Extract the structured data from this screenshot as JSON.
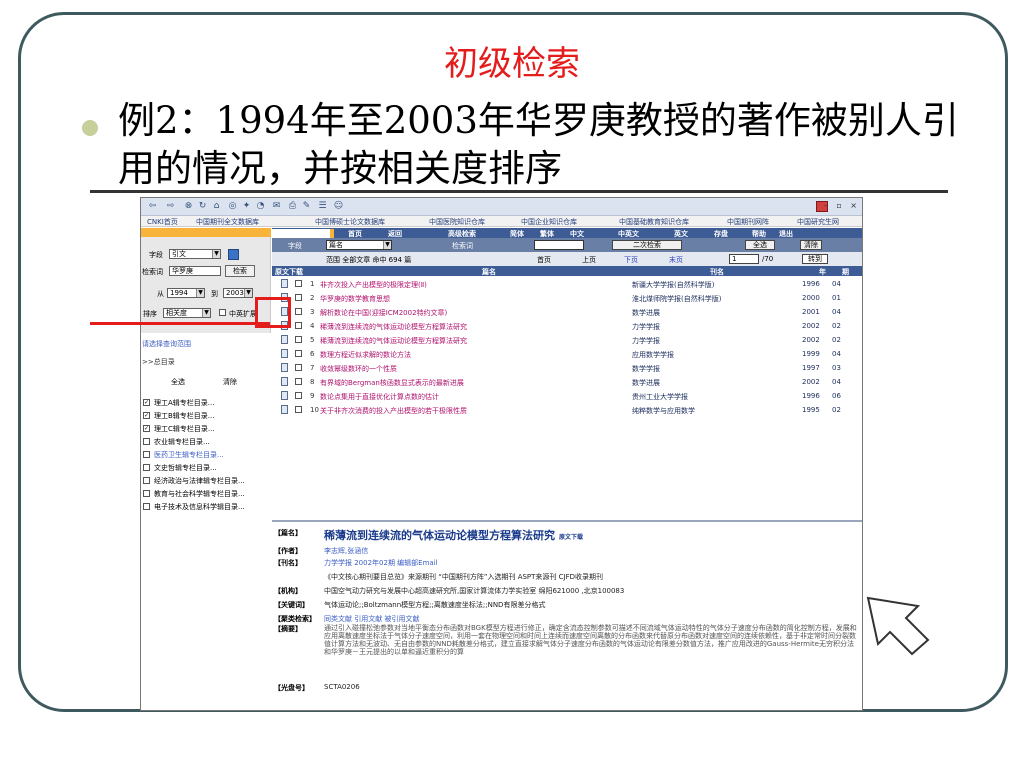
{
  "slide": {
    "title": "初级检索",
    "bullet": "例2：1994年至2003年华罗庚教授的著作被别人引用的情况，并按相关度排序"
  },
  "browser": {
    "toolbar_icons": [
      "back-icon",
      "forward-icon",
      "stop-icon",
      "refresh-icon",
      "home-icon",
      "search-icon",
      "favorites-icon",
      "history-icon",
      "mail-icon",
      "print-icon",
      "edit-icon",
      "discuss-icon",
      "messenger-icon"
    ]
  },
  "topnav": [
    "CNKI首页",
    "中国期刊全文数据库",
    "中国博硕士论文数据库",
    "中国医院知识仓库",
    "中国企业知识仓库",
    "中国基础教育知识仓库",
    "中国期刊网阵",
    "中国研究生网"
  ],
  "sidebar": {
    "field_label": "字段",
    "field_value": "引文",
    "keyword_label": "检索词",
    "keyword_value": "华罗庚",
    "search_btn": "检索",
    "from_label": "从",
    "from_year": "1994",
    "to_label": "到",
    "to_year": "2003",
    "sort_label": "排序",
    "sort_value": "相关度",
    "match_label": "中英扩展",
    "scope_link": "请选择查询范围",
    "total_dir": ">>总目录",
    "select_all": "全选",
    "clear": "清除",
    "categories": [
      {
        "label": "理工A辑专栏目录...",
        "checked": true,
        "link": false
      },
      {
        "label": "理工B辑专栏目录...",
        "checked": true,
        "link": false
      },
      {
        "label": "理工C辑专栏目录...",
        "checked": true,
        "link": false
      },
      {
        "label": "农业辑专栏目录...",
        "checked": false,
        "link": false
      },
      {
        "label": "医药卫生辑专栏目录...",
        "checked": false,
        "link": true
      },
      {
        "label": "文史哲辑专栏目录...",
        "checked": false,
        "link": false
      },
      {
        "label": "经济政治与法律辑专栏目录...",
        "checked": false,
        "link": false
      },
      {
        "label": "教育与社会科学辑专栏目录...",
        "checked": false,
        "link": false
      },
      {
        "label": "电子技术及信息科学辑目录...",
        "checked": false,
        "link": false
      }
    ]
  },
  "menubar": [
    "首页",
    "返回",
    "高级检索",
    "简体",
    "繁体",
    "中文",
    "中英文",
    "英文",
    "存盘",
    "帮助",
    "退出"
  ],
  "fieldrow": {
    "field_label": "字段",
    "field_value": "篇名",
    "keyword_label": "检索词",
    "secondary_btn": "二次检索",
    "select_all_btn": "全选",
    "clear_btn": "清除"
  },
  "rangerow": {
    "summary": "范围 全部文章 命中 694 篇",
    "first": "首页",
    "prev": "上页",
    "next": "下页",
    "last": "末页",
    "page": "1",
    "total_pages": "/70",
    "goto": "转到"
  },
  "table": {
    "headers": {
      "download": "原文下载",
      "title": "篇名",
      "journal": "刊名",
      "year": "年",
      "issue": "期"
    },
    "rows": [
      {
        "num": "1",
        "title": "非齐次投入产出模型的极限定理(Ⅱ)",
        "journal": "新疆大学学报(自然科学版)",
        "year": "1996",
        "issue": "04"
      },
      {
        "num": "2",
        "title": "华罗庚的数学教育思想",
        "journal": "淮北煤师院学报(自然科学版)",
        "year": "2000",
        "issue": "01"
      },
      {
        "num": "3",
        "title": "解析数论在中国(迎接ICM2002特约文章)",
        "journal": "数学进展",
        "year": "2001",
        "issue": "04"
      },
      {
        "num": "4",
        "title": "稀薄流到连续流的气体运动论模型方程算法研究",
        "journal": "力学学报",
        "year": "2002",
        "issue": "02"
      },
      {
        "num": "5",
        "title": "稀薄流到连续流的气体运动论模型方程算法研究",
        "journal": "力学学报",
        "year": "2002",
        "issue": "02"
      },
      {
        "num": "6",
        "title": "数理方程近似求解的数论方法",
        "journal": "应用数学学报",
        "year": "1999",
        "issue": "04"
      },
      {
        "num": "7",
        "title": "收敛幂级数环的一个性质",
        "journal": "数学学报",
        "year": "1997",
        "issue": "03"
      },
      {
        "num": "8",
        "title": "有界域的Bergman核函数显式表示的最新进展",
        "journal": "数学进展",
        "year": "2002",
        "issue": "04"
      },
      {
        "num": "9",
        "title": "数论点集用于直接优化计算点数的估计",
        "journal": "贵州工业大学学报",
        "year": "1996",
        "issue": "06"
      },
      {
        "num": "10",
        "title": "关于非齐次消费的投入产出模型的若干极限性质",
        "journal": "纯粹数学与应用数学",
        "year": "1995",
        "issue": "02"
      }
    ]
  },
  "detail": {
    "title_label": "【篇名】",
    "title": "稀薄流到连续流的气体运动论模型方程算法研究",
    "download": "原文下载",
    "author_label": "【作者】",
    "author": "李志辉,张涵信",
    "journal_label": "【刊名】",
    "journal": "力学学报 2002年02期 编辑部Email",
    "index_line": "《中文核心期刊要目总览》来源期刊 “中国期刊方阵”入选期刊 ASPT来源刊 CJFD收录期刊",
    "org_label": "【机构】",
    "org": "中国空气动力研究与发展中心超高速研究所,国家计算流体力学实验室 绵阳621000 ,北京100083",
    "keywords_label": "【关键词】",
    "keywords": "气体运动论;;Boltzmann模型方程;;离散速度坐标法;;NND有限差分格式",
    "links_label": "【聚类检索】",
    "links": "同类文献 引用文献 被引用文献",
    "abstract_label": "【摘要】",
    "abstract": "通过引入碰撞松弛参数对当地平衡态分布函数对BGK模型方程进行修正，确定含流态控制参数可描述不同流域气体运动特性的气体分子速度分布函数的简化控制方程，发展和应用离散速度坐标法于气体分子速度空间，利用一套在物理空间和时间上连续而速度空间离散的分布函数来代替原分布函数对速度空间的连续依赖性，基于非定常时间分裂数值计算方法和无波动、无自由参数的NND耗散差分格式，建立直接求解气体分子速度分布函数的气体运动论有限差分数值方法，推广应用改进的Gauss-Hermite无穷积分法和华罗庚－王元提出的以单和逼近重积分的算",
    "disc_label": "【光盘号】",
    "disc": "SCTA0206"
  }
}
